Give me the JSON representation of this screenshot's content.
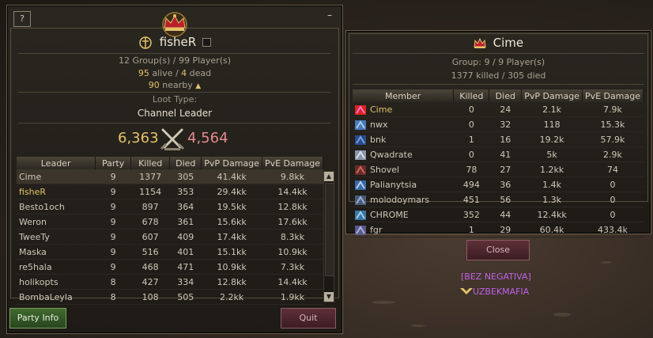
{
  "party_window": {
    "help_label": "?",
    "minimize_label": "–",
    "leader_name": "fisheR",
    "groups_players": "12 Group(s) / 99 Player(s)",
    "alive": "95",
    "alive_label": "alive /",
    "dead": "4",
    "dead_label": "dead",
    "nearby": "90",
    "nearby_label": "nearby",
    "loot_type_label": "Loot Type:",
    "loot_type_value": "Channel Leader",
    "score_left": "6,363",
    "score_right": "4,564",
    "columns": [
      "Leader",
      "Party",
      "Killed",
      "Died",
      "PvP Damage",
      "PvE Damage"
    ],
    "rows": [
      {
        "leader": "Cime",
        "party": "9",
        "killed": "1377",
        "died": "305",
        "pvp": "41.4kk",
        "pve": "9.8kk",
        "selected": true
      },
      {
        "leader": "fisheR",
        "party": "9",
        "killed": "1154",
        "died": "353",
        "pvp": "29.4kk",
        "pve": "14.4kk",
        "self": true
      },
      {
        "leader": "Besto1och",
        "party": "9",
        "killed": "897",
        "died": "364",
        "pvp": "19.5kk",
        "pve": "12.8kk"
      },
      {
        "leader": "Weron",
        "party": "9",
        "killed": "678",
        "died": "361",
        "pvp": "15.6kk",
        "pve": "17.6kk"
      },
      {
        "leader": "TweeTy",
        "party": "9",
        "killed": "607",
        "died": "409",
        "pvp": "17.4kk",
        "pve": "8.3kk"
      },
      {
        "leader": "Maska",
        "party": "9",
        "killed": "516",
        "died": "401",
        "pvp": "15.1kk",
        "pve": "10.9kk"
      },
      {
        "leader": "re5hala",
        "party": "9",
        "killed": "468",
        "died": "471",
        "pvp": "10.9kk",
        "pve": "7.3kk"
      },
      {
        "leader": "holikopts",
        "party": "8",
        "killed": "427",
        "died": "334",
        "pvp": "12.8kk",
        "pve": "14.4kk"
      },
      {
        "leader": "BombaLeyla",
        "party": "8",
        "killed": "108",
        "died": "505",
        "pvp": "2.2kk",
        "pve": "1.9kk"
      }
    ],
    "party_info_label": "Party Info",
    "quit_label": "Quit"
  },
  "group_window": {
    "title": "Cime",
    "group_info": "Group: 9 / 9 Player(s)",
    "kills_info": "1377 killed / 305 died",
    "columns": [
      "Member",
      "Killed",
      "Died",
      "PvP Damage",
      "PvE Damage"
    ],
    "rows": [
      {
        "member": "Cime",
        "killed": "0",
        "died": "24",
        "pvp": "2.1k",
        "pve": "7.9k",
        "icon": "gladiator-class-icon",
        "leader": true
      },
      {
        "member": "nwx",
        "killed": "0",
        "died": "32",
        "pvp": "118",
        "pve": "15.3k",
        "icon": "wizard-class-icon"
      },
      {
        "member": "bnk",
        "killed": "1",
        "died": "16",
        "pvp": "19.2k",
        "pve": "57.9k",
        "icon": "sorcerer-class-icon"
      },
      {
        "member": "Qwadrate",
        "killed": "0",
        "died": "41",
        "pvp": "5k",
        "pve": "2.9k",
        "icon": "knight-class-icon"
      },
      {
        "member": "Shovel",
        "killed": "78",
        "died": "27",
        "pvp": "1.2kk",
        "pve": "74",
        "icon": "warrior-class-icon"
      },
      {
        "member": "Palianytsia",
        "killed": "494",
        "died": "36",
        "pvp": "1.4k",
        "pve": "0",
        "icon": "healer-class-icon"
      },
      {
        "member": "molodoymars",
        "killed": "451",
        "died": "56",
        "pvp": "1.3k",
        "pve": "0",
        "icon": "summoner-class-icon"
      },
      {
        "member": "CHROME",
        "killed": "352",
        "died": "44",
        "pvp": "12.4kk",
        "pve": "0",
        "icon": "archer-class-icon"
      },
      {
        "member": "fgr",
        "killed": "1",
        "died": "29",
        "pvp": "60.4k",
        "pve": "433.4k",
        "icon": "mage-class-icon"
      }
    ],
    "close_label": "Close"
  },
  "world": {
    "clan_tag": "[BEZ NEGATIVA]",
    "alliance_name": "UZBEKMAFIA"
  },
  "colors": {
    "gold_text": "#e3c26b",
    "red_text": "#e58b8e",
    "clan_purple": "#c060e8"
  }
}
